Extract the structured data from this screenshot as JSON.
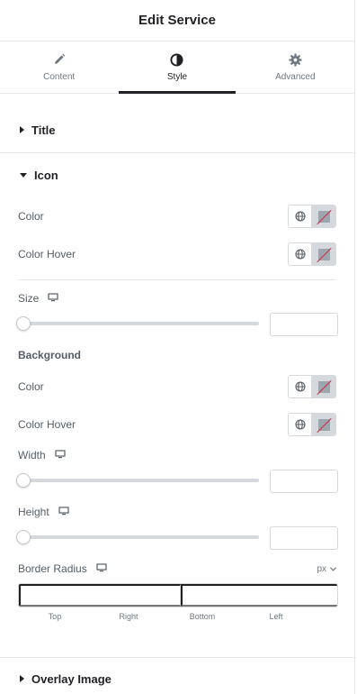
{
  "header": {
    "title": "Edit Service"
  },
  "tabs": [
    {
      "label": "Content",
      "icon": "pencil-icon",
      "active": false
    },
    {
      "label": "Style",
      "icon": "contrast-icon",
      "active": true
    },
    {
      "label": "Advanced",
      "icon": "gear-icon",
      "active": false
    }
  ],
  "sections": {
    "title": {
      "label": "Title",
      "expanded": false
    },
    "icon": {
      "label": "Icon",
      "expanded": true
    },
    "overlay": {
      "label": "Overlay Image",
      "expanded": false
    }
  },
  "icon_controls": {
    "color_label": "Color",
    "color_hover_label": "Color Hover",
    "size_label": "Size",
    "size_value": "",
    "background_heading": "Background",
    "bg_color_label": "Color",
    "bg_color_hover_label": "Color Hover",
    "width_label": "Width",
    "width_value": "",
    "height_label": "Height",
    "height_value": "",
    "border_radius_label": "Border Radius",
    "unit": "px",
    "dimensions": [
      "Top",
      "Right",
      "Bottom",
      "Left"
    ]
  },
  "colors": {
    "accent": "#1f2124",
    "border": "#d5d8dc",
    "clear_slash": "#d72b3f"
  }
}
